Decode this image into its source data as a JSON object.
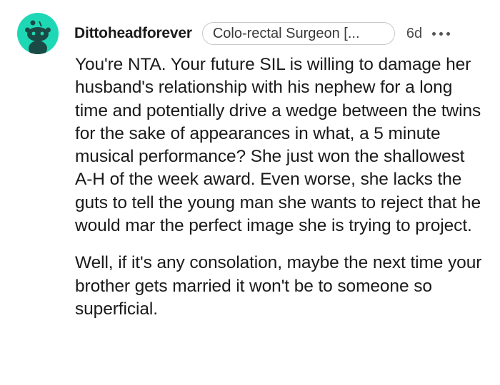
{
  "comment": {
    "username": "Dittoheadforever",
    "flair": "Colo-rectal Surgeon [...",
    "timestamp": "6d",
    "more_label": "•••",
    "avatar_icon": "snoo-avatar-icon",
    "avatar_color": "#1ed8b5",
    "paragraphs": [
      "You're NTA. Your future SIL is willing to damage her husband's relationship with his nephew for a long time and potentially drive a wedge between the twins for the sake of appearances in what, a 5 minute musical performance? She just won the shallowest A-H of the week award. Even worse, she lacks the guts to tell the young man she wants to reject that he would mar the perfect image she is trying to project.",
      "Well, if it's any consolation, maybe the next time your brother gets married it won't be to someone so superficial."
    ]
  }
}
